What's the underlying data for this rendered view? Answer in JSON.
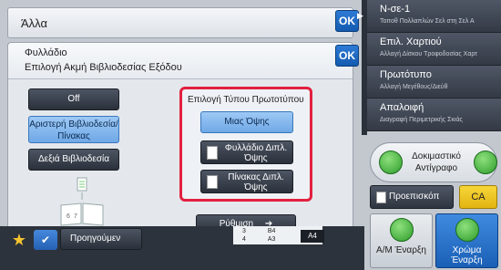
{
  "header": {
    "title": "Άλλα",
    "ok_label": "OK"
  },
  "dialog": {
    "title": "Φυλλάδιο",
    "subtitle": "Επιλογή Ακμή Βιβλιοδεσίας Εξόδου",
    "ok_label": "OK",
    "binding": {
      "off": "Off",
      "left": "Αριστερή Βιβλιοδεσία/ Πίνακας",
      "right": "Δεξιά Βιβλιοδεσία",
      "selected": "left"
    },
    "original_type": {
      "title": "Επιλογή Τύπου Πρωτοτύπου",
      "single": "Μιας Όψης",
      "booklet": "Φυλλάδιο Διπλ. Όψης",
      "tablet": "Πίνακας Διπλ. Όψης",
      "selected": "single"
    },
    "setting_label": "Ρύθμιση",
    "illustration_pages": "6 7"
  },
  "sidebar": {
    "items": [
      {
        "main": "N-σε-1",
        "sub": "Τοποθ Πολλαπλών Σελ στη Σελ Α"
      },
      {
        "main": "Επιλ. Χαρτιού",
        "sub": "Αλλαγή Δίσκου Τροφοδοσίας Χαρτ"
      },
      {
        "main": "Πρωτότυπο",
        "sub": "Αλλαγή Μεγέθους/Διεύθ"
      },
      {
        "main": "Απαλοιφή",
        "sub": "Διαγραφή Περιμετρικής Σκιάς"
      }
    ]
  },
  "actions": {
    "test_copy": "Δοκιμαστικό Αντίγραφο",
    "preview": "Προεπισκόπ",
    "ca": "CA",
    "bw_start": "Α/Μ Έναρξη",
    "color_start": "Χρώμα Έναρξη"
  },
  "bottom": {
    "prev": "Προηγούμεν",
    "tray_row1_num": "3",
    "tray_row1_size": "B4",
    "tray_row2_num": "4",
    "tray_row2_size": "A3",
    "current_size": "A4"
  },
  "colors": {
    "accent": "#1b5fb5",
    "highlight": "#e2203f",
    "selected": "#7fb4ec",
    "ca": "#eec51f"
  }
}
